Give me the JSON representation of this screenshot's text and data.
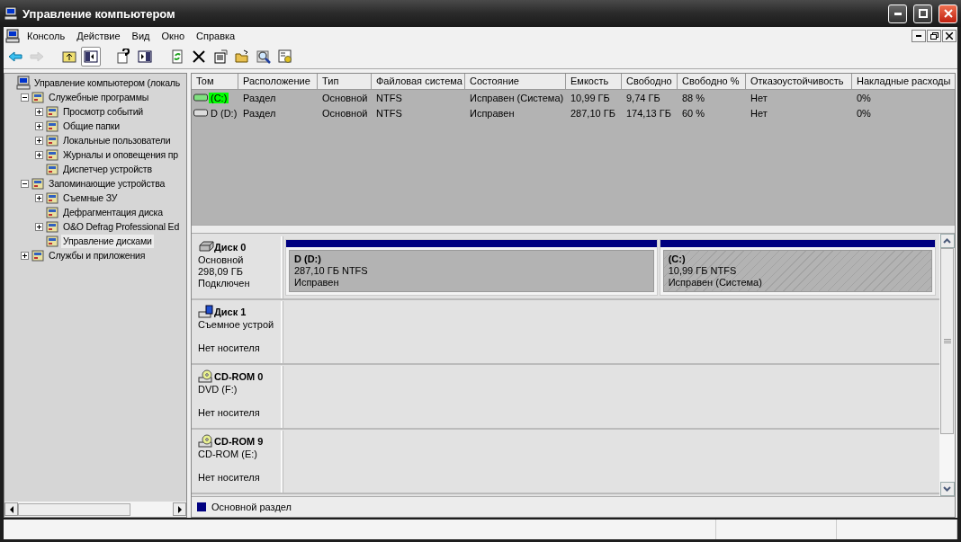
{
  "window": {
    "title": "Управление компьютером"
  },
  "menu": [
    "Консоль",
    "Действие",
    "Вид",
    "Окно",
    "Справка"
  ],
  "toolbar": [
    {
      "kind": "back",
      "pressed": false,
      "disabled": false
    },
    {
      "kind": "forward",
      "pressed": false,
      "disabled": true
    },
    {
      "kind": "up",
      "pressed": false,
      "disabled": false
    },
    {
      "kind": "tree",
      "pressed": true,
      "disabled": false
    },
    {
      "kind": "help",
      "pressed": false,
      "disabled": false
    },
    {
      "kind": "pane",
      "pressed": false,
      "disabled": false
    },
    {
      "kind": "refresh",
      "pressed": false,
      "disabled": false
    },
    {
      "kind": "delete",
      "pressed": false,
      "disabled": false
    },
    {
      "kind": "properties",
      "pressed": false,
      "disabled": false
    },
    {
      "kind": "open",
      "pressed": false,
      "disabled": false
    },
    {
      "kind": "find",
      "pressed": false,
      "disabled": false
    },
    {
      "kind": "settings",
      "pressed": false,
      "disabled": false
    }
  ],
  "tree": [
    {
      "label": "Управление компьютером (локаль",
      "expandable": false,
      "selected": false,
      "children": [
        {
          "label": "Служебные программы",
          "expandable": true,
          "expanded": true,
          "selected": false,
          "children": [
            {
              "label": "Просмотр событий",
              "expandable": true,
              "expanded": false,
              "selected": false
            },
            {
              "label": "Общие папки",
              "expandable": true,
              "expanded": false,
              "selected": false
            },
            {
              "label": "Локальные пользователи",
              "expandable": true,
              "expanded": false,
              "selected": false
            },
            {
              "label": "Журналы и оповещения пр",
              "expandable": true,
              "expanded": false,
              "selected": false
            },
            {
              "label": "Диспетчер устройств",
              "expandable": false,
              "selected": false
            }
          ]
        },
        {
          "label": "Запоминающие устройства",
          "expandable": true,
          "expanded": true,
          "selected": false,
          "children": [
            {
              "label": "Съемные ЗУ",
              "expandable": true,
              "expanded": false,
              "selected": false
            },
            {
              "label": "Дефрагментация диска",
              "expandable": false,
              "selected": false
            },
            {
              "label": "O&O Defrag Professional Ed",
              "expandable": true,
              "expanded": false,
              "selected": false
            },
            {
              "label": "Управление дисками",
              "expandable": false,
              "selected": true
            }
          ]
        },
        {
          "label": "Службы и приложения",
          "expandable": true,
          "expanded": false,
          "selected": false
        }
      ]
    }
  ],
  "table": {
    "columns": [
      "Том",
      "Расположение",
      "Тип",
      "Файловая система",
      "Состояние",
      "Емкость",
      "Свободно",
      "Свободно %",
      "Отказоустойчивость",
      "Накладные расходы"
    ],
    "rows": [
      {
        "selected": true,
        "cells": [
          "(C:)",
          "Раздел",
          "Основной",
          "NTFS",
          "Исправен (Система)",
          "10,99 ГБ",
          "9,74 ГБ",
          "88 %",
          "Нет",
          "0%"
        ]
      },
      {
        "selected": false,
        "cells": [
          "D (D:)",
          "Раздел",
          "Основной",
          "NTFS",
          "Исправен",
          "287,10 ГБ",
          "174,13 ГБ",
          "60 %",
          "Нет",
          "0%"
        ]
      }
    ]
  },
  "disks": [
    {
      "kind": "hdd",
      "name": "Диск 0",
      "details": [
        "Основной",
        "298,09 ГБ"
      ],
      "status": "Подключен",
      "partitions": [
        {
          "name": "D  (D:)",
          "size": "287,10 ГБ NTFS",
          "status": "Исправен",
          "selected": false
        },
        {
          "name": " (C:)",
          "size": "10,99 ГБ NTFS",
          "status": "Исправен (Система)",
          "selected": true
        }
      ]
    },
    {
      "kind": "removable",
      "name": "Диск 1",
      "details": [
        "Съемное устрой"
      ],
      "status": "Нет носителя"
    },
    {
      "kind": "cdrom",
      "name": "CD-ROM 0",
      "details": [
        "DVD (F:)"
      ],
      "status": "Нет носителя"
    },
    {
      "kind": "cdrom",
      "name": "CD-ROM 9",
      "details": [
        "CD-ROM (E:)"
      ],
      "status": "Нет носителя"
    }
  ],
  "legend": [
    {
      "label": "Основной раздел",
      "color": "#000080"
    }
  ]
}
